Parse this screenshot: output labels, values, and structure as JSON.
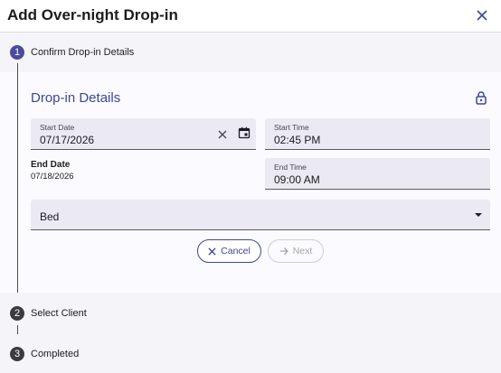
{
  "dialog": {
    "title": "Add Over-night Drop-in"
  },
  "steps": [
    {
      "number": "1",
      "label": "Confirm Drop-in Details",
      "state": "active"
    },
    {
      "number": "2",
      "label": "Select Client",
      "state": "inactive"
    },
    {
      "number": "3",
      "label": "Completed",
      "state": "inactive"
    }
  ],
  "details": {
    "section_title": "Drop-in Details",
    "start_date": {
      "label": "Start Date",
      "value": "07/17/2026"
    },
    "start_time": {
      "label": "Start Time",
      "value": "02:45 PM"
    },
    "end_date": {
      "label": "End Date",
      "value": "07/18/2026"
    },
    "end_time": {
      "label": "End Time",
      "value": "09:00 AM"
    },
    "bed": {
      "value": "Bed"
    }
  },
  "actions": {
    "cancel_label": "Cancel",
    "next_label": "Next"
  },
  "colors": {
    "accent": "#3f4596",
    "step_active": "#4a4a9e",
    "step_inactive": "#3a3a3f"
  },
  "icons": {
    "close": "close-icon",
    "lock": "lock-icon",
    "clear": "clear-icon",
    "calendar": "calendar-icon",
    "dropdown": "chevron-down-icon",
    "arrow": "arrow-right-icon"
  }
}
